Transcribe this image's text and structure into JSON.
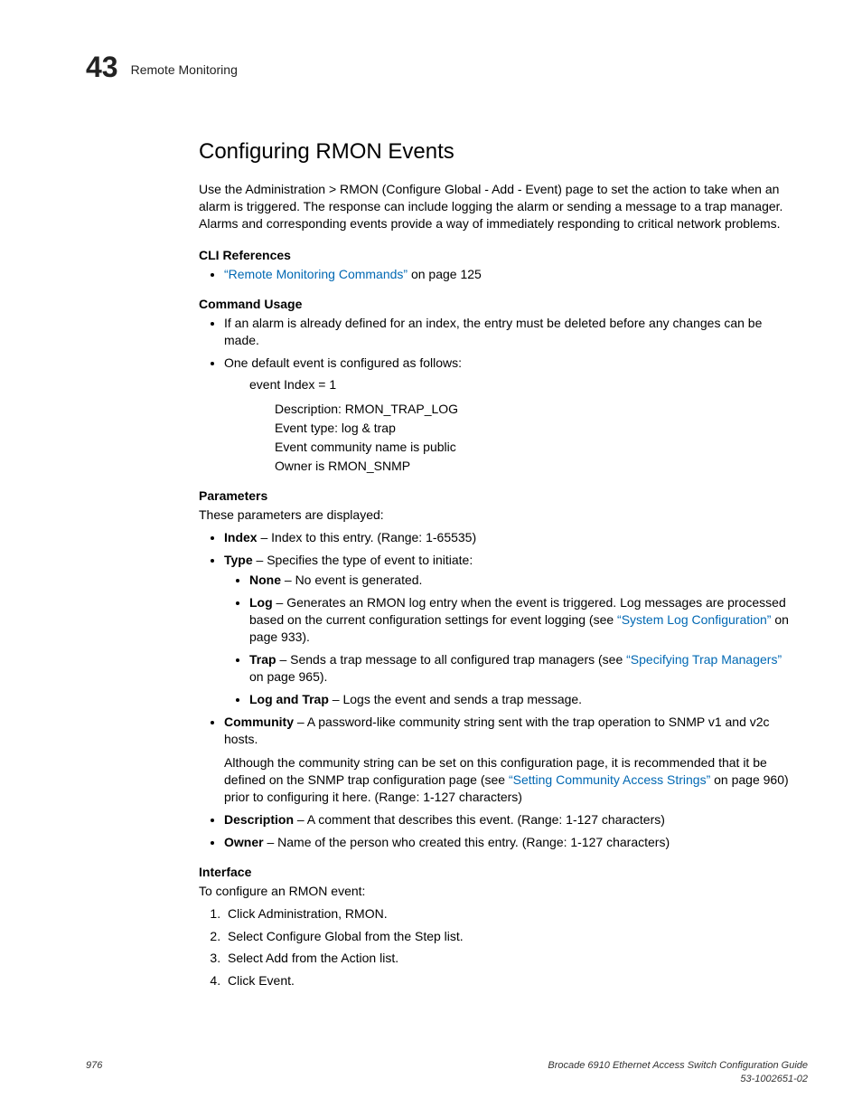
{
  "header": {
    "chapter_number": "43",
    "section": "Remote Monitoring"
  },
  "topic_title": "Configuring RMON Events",
  "intro": "Use the Administration > RMON (Configure Global - Add - Event) page to set the action to take when an alarm is triggered. The response can include logging the alarm or sending a message to a trap manager. Alarms and corresponding events provide a way of immediately responding to critical network problems.",
  "cli_ref": {
    "heading": "CLI References",
    "link_text": "“Remote Monitoring Commands”",
    "suffix": " on page 125"
  },
  "usage": {
    "heading": "Command Usage",
    "item1": "If an alarm is already defined for an index, the entry must be deleted before any changes can be made.",
    "item2": "One default event is configured as follows:",
    "default_line": "event Index = 1",
    "desc1": "Description: RMON_TRAP_LOG",
    "desc2": "Event type: log & trap",
    "desc3": "Event community name is public",
    "desc4": "Owner is RMON_SNMP"
  },
  "params": {
    "heading": "Parameters",
    "intro": "These parameters are displayed:",
    "index": {
      "label": "Index",
      "text": " – Index to this entry. (Range: 1-65535)"
    },
    "type": {
      "label": "Type",
      "text": " – Specifies the type of event to initiate:"
    },
    "none": {
      "label": "None",
      "text": " – No event is generated."
    },
    "log": {
      "label": "Log",
      "t1": " – Generates an RMON log entry when the event is triggered. Log messages are processed based on the current configuration settings for event logging (see ",
      "link": "“System Log Configuration”",
      "t2": " on page 933)."
    },
    "trap": {
      "label": "Trap",
      "t1": " – Sends a trap message to all configured trap managers (see ",
      "link": "“Specifying Trap Managers”",
      "t2": " on page 965)."
    },
    "logtrap": {
      "label": "Log and Trap",
      "text": " – Logs the event and sends a trap message."
    },
    "community": {
      "label": "Community",
      "t1": " – A password-like community string sent with the trap operation to SNMP v1 and v2c hosts.",
      "p2a": "Although the community string can be set on this configuration page, it is recommended that it be defined on the SNMP trap configuration page (see ",
      "link": "“Setting Community Access Strings”",
      "p2b": " on page 960) prior to configuring it here. (Range: 1-127 characters)"
    },
    "description": {
      "label": "Description",
      "text": " – A comment that describes this event. (Range: 1-127 characters)"
    },
    "owner": {
      "label": "Owner",
      "text": " – Name of the person who created this entry. (Range: 1-127 characters)"
    }
  },
  "interface": {
    "heading": "Interface",
    "intro": "To configure an RMON event:",
    "steps": [
      "Click Administration, RMON.",
      "Select Configure Global from the Step list.",
      "Select Add from the Action list.",
      "Click Event."
    ]
  },
  "footer": {
    "page": "976",
    "doc_title": "Brocade 6910 Ethernet Access Switch Configuration Guide",
    "doc_number": "53-1002651-02"
  }
}
